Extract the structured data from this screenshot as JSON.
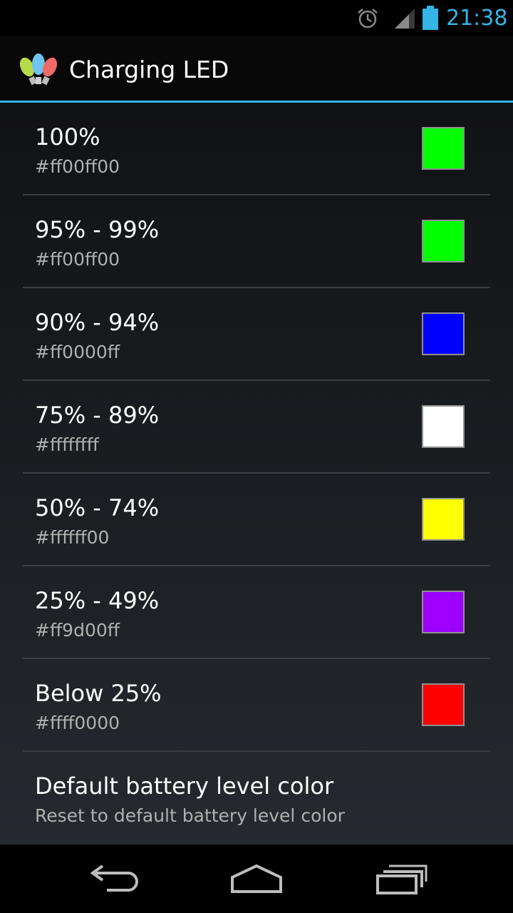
{
  "status_bar": {
    "time": "21:38",
    "icons": [
      "alarm-icon",
      "signal-icon",
      "battery-icon"
    ],
    "accent": "#33b5e5"
  },
  "action_bar": {
    "title": "Charging LED",
    "app_icon": "christmas-lights-icon"
  },
  "preferences": [
    {
      "label": "100%",
      "value": "#ff00ff00",
      "color": "#00ff00"
    },
    {
      "label": "95% - 99%",
      "value": "#ff00ff00",
      "color": "#00ff00"
    },
    {
      "label": "90% - 94%",
      "value": "#ff0000ff",
      "color": "#0000ff"
    },
    {
      "label": "75% - 89%",
      "value": "#ffffffff",
      "color": "#ffffff"
    },
    {
      "label": "50% - 74%",
      "value": "#ffffff00",
      "color": "#ffff00"
    },
    {
      "label": "25% - 49%",
      "value": "#ff9d00ff",
      "color": "#9d00ff"
    },
    {
      "label": "Below 25%",
      "value": "#ffff0000",
      "color": "#ff0000"
    }
  ],
  "reset": {
    "label": "Default battery level color",
    "summary": "Reset to default battery level color"
  },
  "nav_bar": {
    "icons": [
      "back-icon",
      "home-icon",
      "recents-icon"
    ]
  }
}
